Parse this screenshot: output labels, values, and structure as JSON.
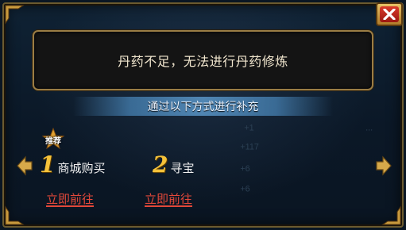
{
  "dialog": {
    "message": "丹药不足，无法进行丹药修炼",
    "subtitle": "通过以下方式进行补充",
    "close_icon": "close-x-icon"
  },
  "options": [
    {
      "number": "1",
      "label": "商城购买",
      "badge": "推荐",
      "action": "立即前往"
    },
    {
      "number": "2",
      "label": "寻宝",
      "action": "立即前往"
    }
  ],
  "colors": {
    "accent_gold": "#f5c23a",
    "link_red": "#e2483a",
    "frame_gold": "#9a7d45"
  }
}
